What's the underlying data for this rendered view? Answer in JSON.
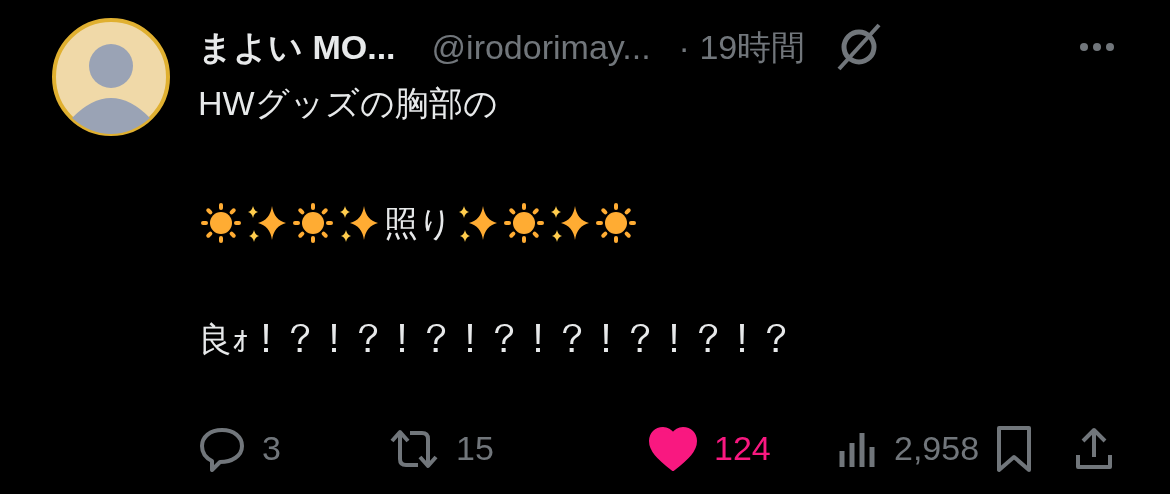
{
  "author": {
    "name": "まよい MO...",
    "handle": "@irodorimay...",
    "time": "· 19時間"
  },
  "body": {
    "line_1": "HWグッズの胸部の",
    "emoji_line": [
      {
        "kind": "sun"
      },
      {
        "kind": "sparkles"
      },
      {
        "kind": "sun"
      },
      {
        "kind": "sparkles"
      },
      {
        "kind": "text",
        "text": "照り"
      },
      {
        "kind": "sparkles"
      },
      {
        "kind": "sun"
      },
      {
        "kind": "sparkles"
      },
      {
        "kind": "sun"
      }
    ],
    "line_3": "良ｫ！？！？！？！？！？！？！？！？"
  },
  "actions": {
    "replies": "3",
    "reposts": "15",
    "likes": "124",
    "liked": true,
    "views": "2,958"
  }
}
